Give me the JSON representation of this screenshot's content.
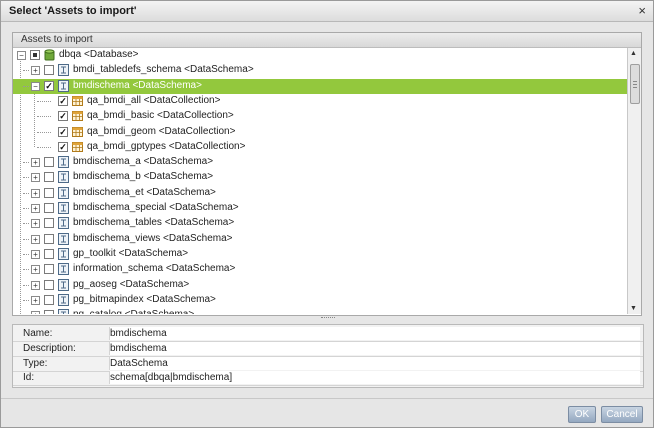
{
  "dialog": {
    "title": "Select 'Assets to import'",
    "close_glyph": "×"
  },
  "panel": {
    "header": "Assets to import"
  },
  "tree": [
    {
      "label": "dbqa <Database>",
      "level": 0,
      "icon": "database-icon",
      "expander": "−",
      "checked": "partial",
      "selected": false
    },
    {
      "label": "bmdi_tabledefs_schema <DataSchema>",
      "level": 1,
      "icon": "schema-icon",
      "expander": "+",
      "checked": "none",
      "selected": false
    },
    {
      "label": "bmdischema <DataSchema>",
      "level": 1,
      "icon": "schema-icon",
      "expander": "−",
      "checked": "checked",
      "selected": true
    },
    {
      "label": "qa_bmdi_all <DataCollection>",
      "level": 2,
      "icon": "table-icon",
      "expander": "",
      "checked": "checked",
      "selected": false
    },
    {
      "label": "qa_bmdi_basic <DataCollection>",
      "level": 2,
      "icon": "table-icon",
      "expander": "",
      "checked": "checked",
      "selected": false
    },
    {
      "label": "qa_bmdi_geom <DataCollection>",
      "level": 2,
      "icon": "table-icon",
      "expander": "",
      "checked": "checked",
      "selected": false
    },
    {
      "label": "qa_bmdi_gptypes <DataCollection>",
      "level": 2,
      "icon": "table-icon",
      "expander": "",
      "checked": "checked",
      "selected": false
    },
    {
      "label": "bmdischema_a <DataSchema>",
      "level": 1,
      "icon": "schema-icon",
      "expander": "+",
      "checked": "none",
      "selected": false
    },
    {
      "label": "bmdischema_b <DataSchema>",
      "level": 1,
      "icon": "schema-icon",
      "expander": "+",
      "checked": "none",
      "selected": false
    },
    {
      "label": "bmdischema_et <DataSchema>",
      "level": 1,
      "icon": "schema-icon",
      "expander": "+",
      "checked": "none",
      "selected": false
    },
    {
      "label": "bmdischema_special <DataSchema>",
      "level": 1,
      "icon": "schema-icon",
      "expander": "+",
      "checked": "none",
      "selected": false
    },
    {
      "label": "bmdischema_tables <DataSchema>",
      "level": 1,
      "icon": "schema-icon",
      "expander": "+",
      "checked": "none",
      "selected": false
    },
    {
      "label": "bmdischema_views <DataSchema>",
      "level": 1,
      "icon": "schema-icon",
      "expander": "+",
      "checked": "none",
      "selected": false
    },
    {
      "label": "gp_toolkit <DataSchema>",
      "level": 1,
      "icon": "schema-icon",
      "expander": "+",
      "checked": "none",
      "selected": false
    },
    {
      "label": "information_schema <DataSchema>",
      "level": 1,
      "icon": "schema-icon",
      "expander": "+",
      "checked": "none",
      "selected": false
    },
    {
      "label": "pg_aoseg <DataSchema>",
      "level": 1,
      "icon": "schema-icon",
      "expander": "+",
      "checked": "none",
      "selected": false
    },
    {
      "label": "pg_bitmapindex <DataSchema>",
      "level": 1,
      "icon": "schema-icon",
      "expander": "+",
      "checked": "none",
      "selected": false
    },
    {
      "label": "pg_catalog <DataSchema>",
      "level": 1,
      "icon": "schema-icon",
      "expander": "+",
      "checked": "none",
      "selected": false
    }
  ],
  "details": {
    "rows": [
      {
        "key": "Name:",
        "value": "bmdischema"
      },
      {
        "key": "Description:",
        "value": "bmdischema"
      },
      {
        "key": "Type:",
        "value": "DataSchema"
      },
      {
        "key": "Id:",
        "value": "schema[dbqa|bmdischema]"
      }
    ]
  },
  "buttons": {
    "ok": "OK",
    "cancel": "Cancel"
  },
  "colors": {
    "selection": "#93c83d",
    "button": "#94a8c0"
  }
}
